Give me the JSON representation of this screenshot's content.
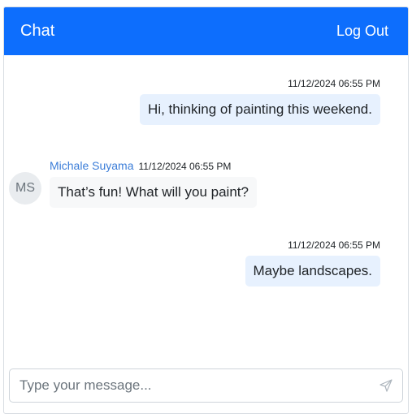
{
  "header": {
    "title": "Chat",
    "logout_label": "Log Out"
  },
  "messages": [
    {
      "direction": "outgoing",
      "timestamp": "11/12/2024 06:55 PM",
      "text": "Hi, thinking of painting this weekend."
    },
    {
      "direction": "incoming",
      "sender": "Michale Suyama",
      "avatar_initials": "MS",
      "timestamp": "11/12/2024 06:55 PM",
      "text": "That’s fun! What will you paint?"
    },
    {
      "direction": "outgoing",
      "timestamp": "11/12/2024 06:55 PM",
      "text": "Maybe landscapes."
    }
  ],
  "composer": {
    "placeholder": "Type your message...",
    "value": "",
    "send_icon": "send-icon"
  },
  "colors": {
    "header_bg": "#0d6efd",
    "outgoing_bubble": "#e7f1fe",
    "incoming_bubble": "#f7f8f9",
    "sender_name": "#3b7dd8"
  }
}
